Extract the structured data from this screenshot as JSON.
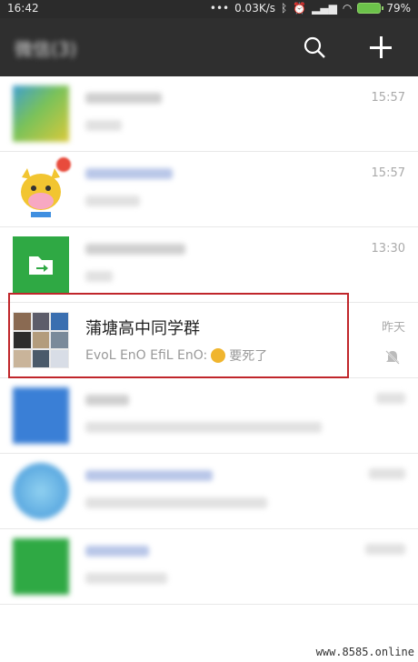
{
  "status_bar": {
    "time": "16:42",
    "dots": "•••",
    "net_speed": "0.03K/s",
    "battery_percent": "79%"
  },
  "top_bar": {
    "title": "微信(3)",
    "search_icon": "search-icon",
    "add_icon": "plus-icon"
  },
  "chats": [
    {
      "time": "15:57",
      "avatar_colors": [
        "#c8d24a",
        "#3f9fd0"
      ]
    },
    {
      "time": "15:57",
      "avatar": "cartoon-cow"
    },
    {
      "time": "13:30",
      "avatar_color": "#2fa944"
    },
    {
      "name": "蒲塘高中同学群",
      "preview_sender": "EvoL EnO EfiL EnO:",
      "preview_text": "要死了",
      "time": "昨天",
      "muted": true
    },
    {
      "avatar_color": "#3a7fd6"
    },
    {
      "avatar_color": "#5aa8e0"
    },
    {
      "avatar_color": "#2fa944"
    }
  ],
  "watermark": "www.8585.online",
  "colors": {
    "accent_red": "#c0262b",
    "topbar": "#2f2f2f"
  }
}
